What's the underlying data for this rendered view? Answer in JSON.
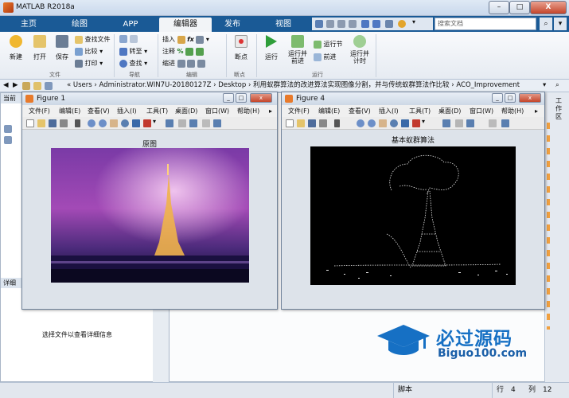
{
  "window": {
    "title": "MATLAB R2018a"
  },
  "tabs": [
    "主页",
    "绘图",
    "APP",
    "编辑器",
    "发布",
    "视图"
  ],
  "search": {
    "placeholder": "搜索文档"
  },
  "ribbon": {
    "new": "新建",
    "open": "打开",
    "save": "保存",
    "find_files": "查找文件",
    "compare": "比较",
    "print": "打印",
    "go_to": "转至",
    "find": "查找",
    "insert": "插入",
    "comment": "注释",
    "indent": "缩进",
    "breakpoints": "断点",
    "run": "运行",
    "run_advance": "运行并\n前进",
    "run_section": "运行节",
    "advance": "前进",
    "run_time": "运行并\n计时",
    "groups": {
      "file": "文件",
      "navigate": "导航",
      "edit": "编辑",
      "breakpoints": "断点",
      "run": "运行"
    }
  },
  "address": {
    "path": "« Users › Administrator.WIN7U-20180127Z › Desktop › 利用蚁群算法的改进算法实现图像分割，并与传统蚁群算法作比较 › ACO_Improvement"
  },
  "left_panel": {
    "current_label": "当前",
    "details_label": "详细",
    "details_text": "选择文件以查看详细信息"
  },
  "right_panel": {
    "workspace_label": "工作区"
  },
  "figure1": {
    "title": "Figure 1",
    "menu": [
      "文件(F)",
      "编辑(E)",
      "查看(V)",
      "插入(I)",
      "工具(T)",
      "桌面(D)",
      "窗口(W)",
      "帮助(H)"
    ],
    "plot_title": "原图"
  },
  "figure4": {
    "title": "Figure 4",
    "menu": [
      "文件(F)",
      "编辑(E)",
      "查看(V)",
      "插入(I)",
      "工具(T)",
      "桌面(D)",
      "窗口(W)",
      "帮助(H)"
    ],
    "plot_title": "基本蚁群算法"
  },
  "watermark": {
    "brand": "必过源码",
    "url": "Biguo100.com"
  },
  "status": {
    "script": "脚本",
    "row_label": "行",
    "row": "4",
    "col_label": "列",
    "col": "12"
  }
}
